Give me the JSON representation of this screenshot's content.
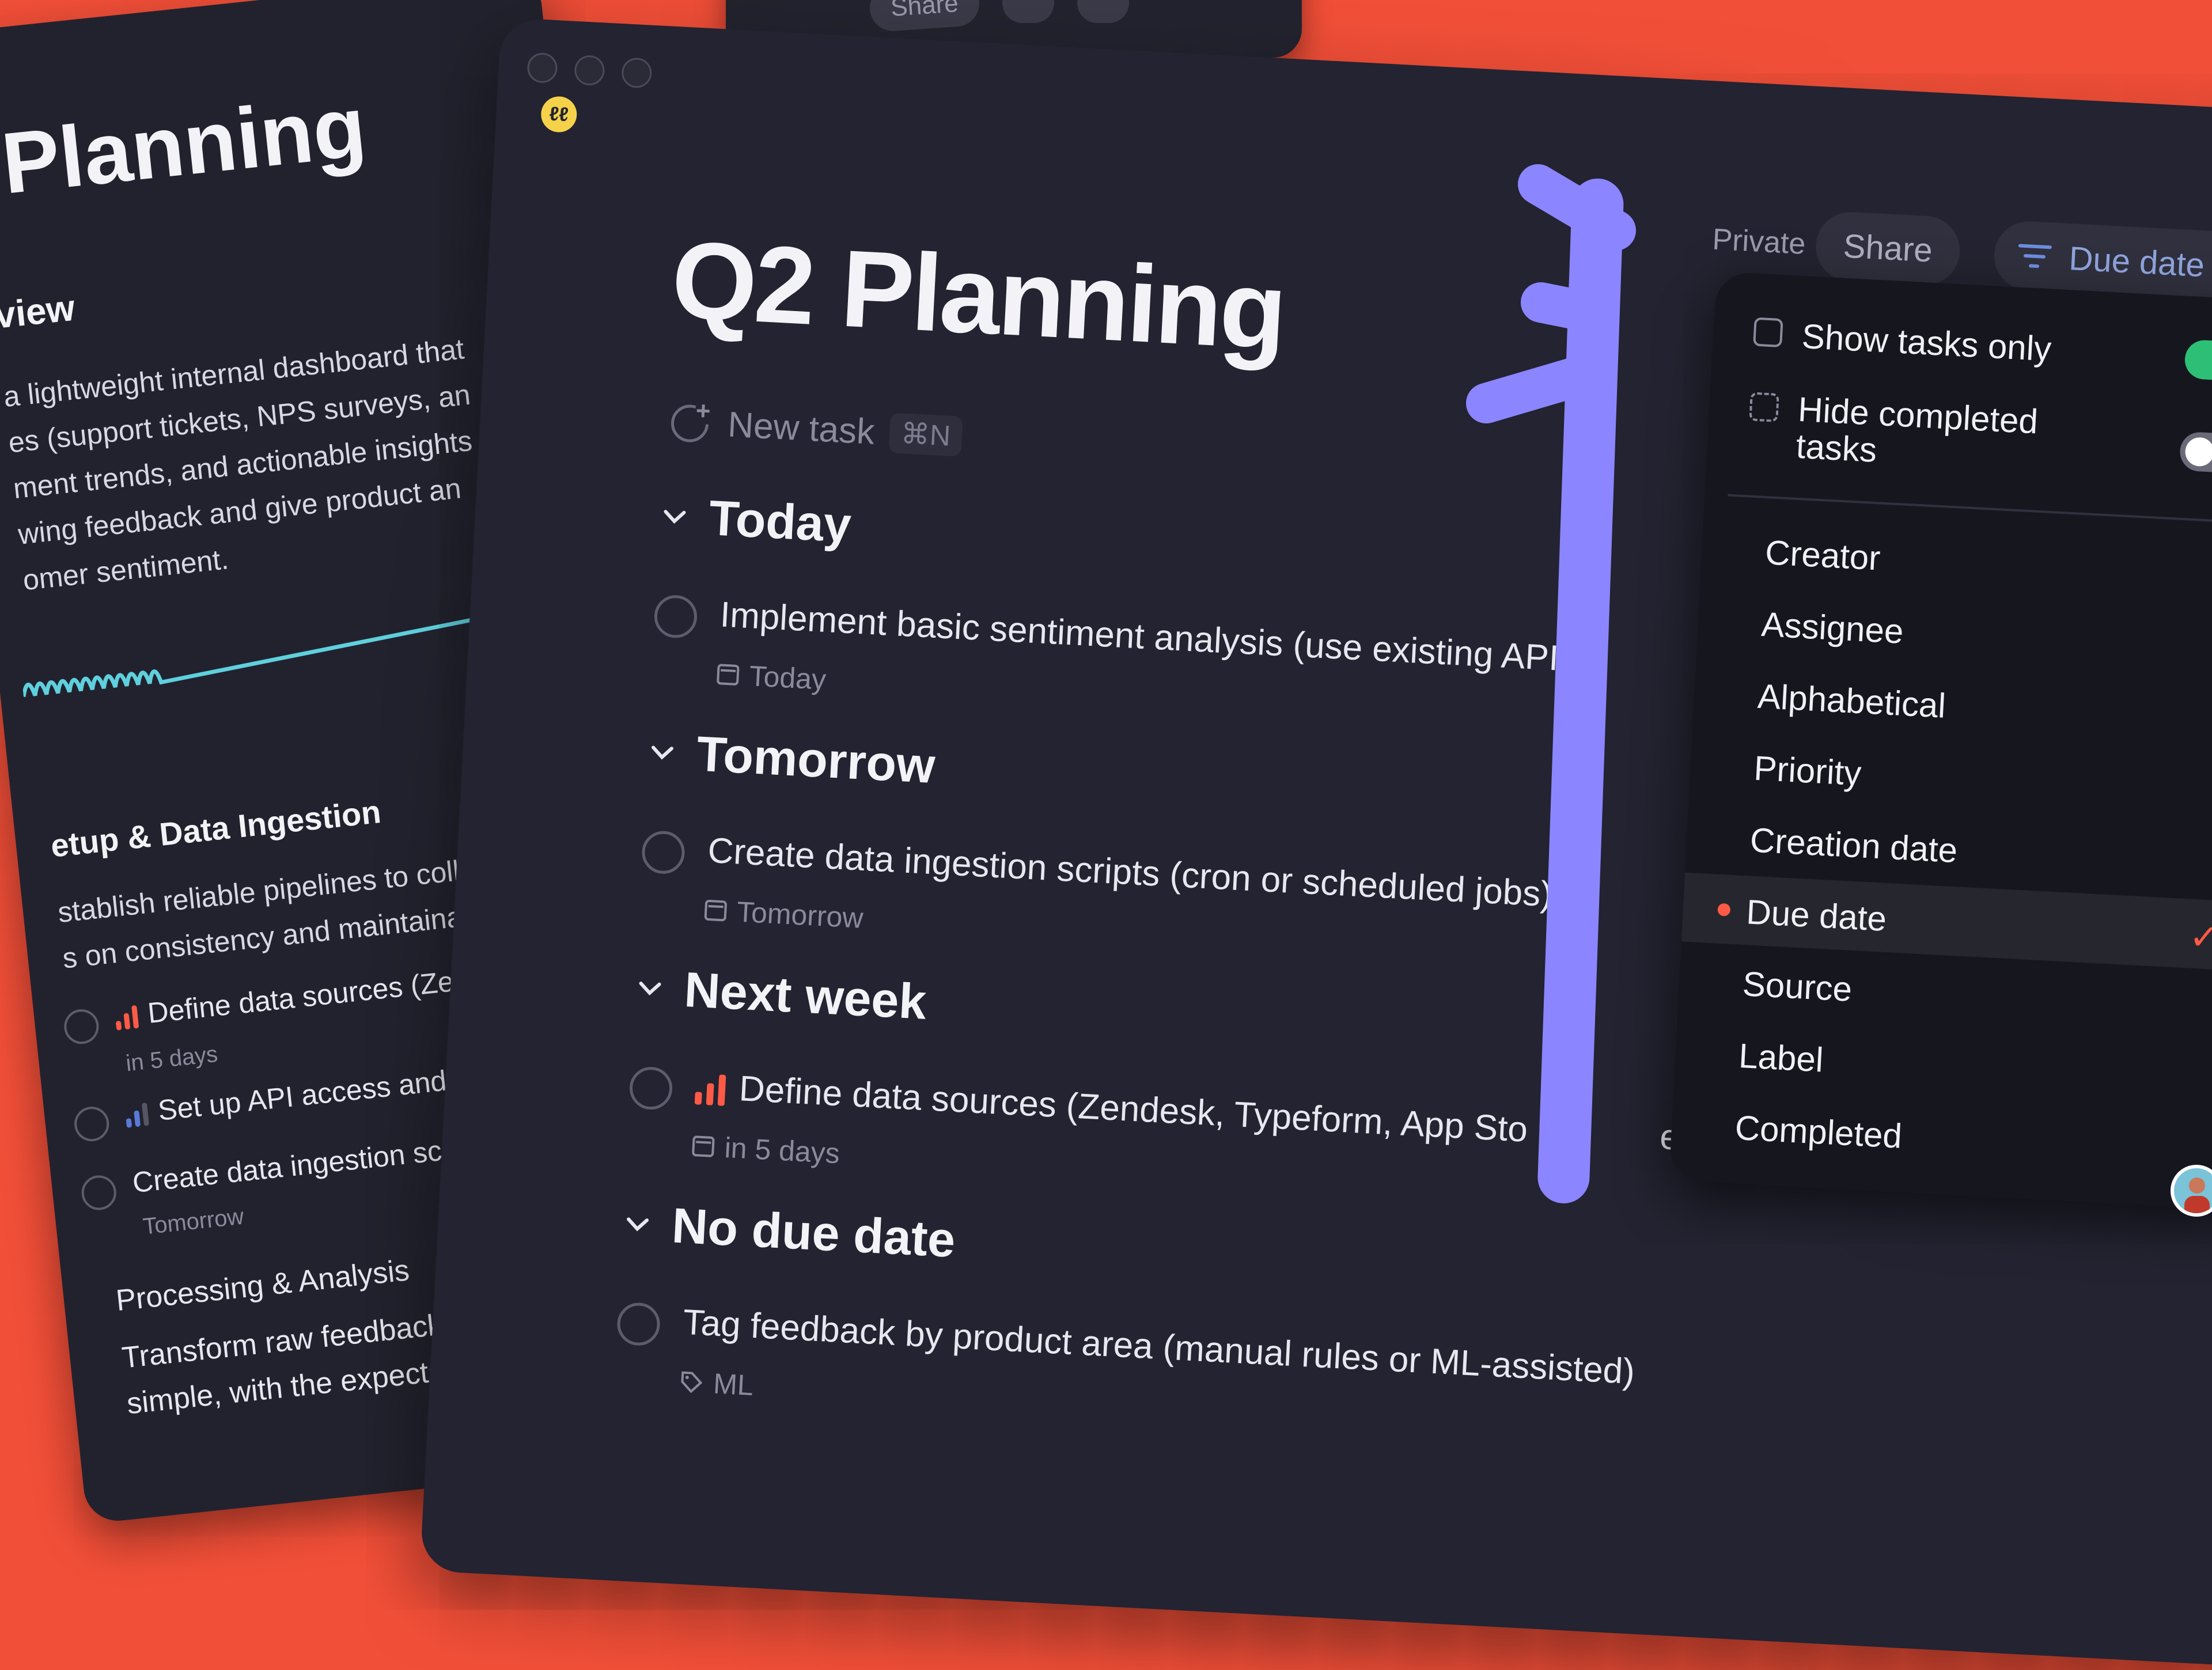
{
  "background_window": {
    "title": "Planning",
    "overview_heading": "view",
    "overview_lines": [
      "a lightweight internal dashboard that",
      "es (support tickets, NPS surveys, an",
      "ment trends, and actionable insights",
      "wing feedback and give product an",
      "omer sentiment."
    ],
    "section_heading": "etup & Data Ingestion",
    "section_lines": [
      "stablish reliable pipelines to colle",
      "s on consistency and maintainabi"
    ],
    "tasks": [
      {
        "title": "Define data sources (Zen",
        "meta": "in 5 days"
      },
      {
        "title": "Set up API access and",
        "meta": ""
      },
      {
        "title": "Create data ingestion scri",
        "meta": "Tomorrow"
      }
    ],
    "subsection_heading": "Processing & Analysis",
    "sub_lines": [
      "Transform raw feedback in",
      "simple, with the expectati"
    ],
    "top_window_share": "Share"
  },
  "main": {
    "title": "Q2 Planning",
    "new_task_label": "New task",
    "new_task_shortcut": "⌘N",
    "private_label": "Private",
    "share_label": "Share",
    "sort_button_label": "Due date",
    "sections": [
      {
        "title": "Today",
        "tasks": [
          {
            "title": "Implement basic sentiment analysis (use existing API",
            "meta": "Today"
          }
        ]
      },
      {
        "title": "Tomorrow",
        "tasks": [
          {
            "title": "Create data ingestion scripts (cron or scheduled jobs)",
            "meta": "Tomorrow"
          }
        ]
      },
      {
        "title": "Next week",
        "tasks": [
          {
            "title": "Define data sources (Zendesk, Typeform, App Sto",
            "title_tail": "etc.)",
            "meta": "in 5 days",
            "priority": "high"
          }
        ]
      },
      {
        "title": "No due date",
        "tasks": [
          {
            "title": "Tag feedback by product area (manual rules or ML-assisted)",
            "meta": "ML"
          }
        ]
      }
    ]
  },
  "dropdown": {
    "show_tasks_only": {
      "label": "Show tasks only",
      "on": true
    },
    "hide_completed": {
      "label_line1": "Hide completed",
      "label_line2": "tasks",
      "on": false
    },
    "options": [
      "Creator",
      "Assignee",
      "Alphabetical",
      "Priority",
      "Creation date",
      "Due date",
      "Source",
      "Label",
      "Completed"
    ],
    "selected": "Due date"
  },
  "colors": {
    "background": "#f24f38",
    "window": "#232331",
    "accent_purple": "#8b86ff",
    "toggle_on": "#2ebf77",
    "priority_red": "#ff5a45"
  }
}
